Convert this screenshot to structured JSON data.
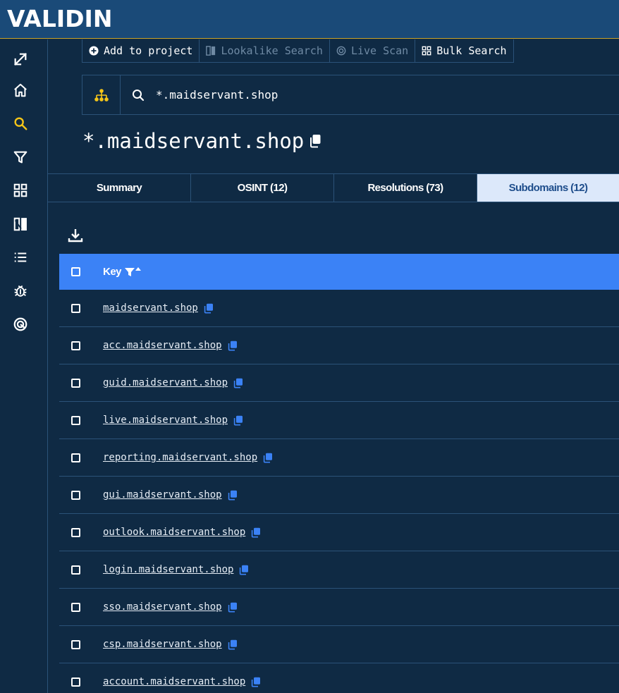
{
  "app": {
    "logo_text": "VALIDIN"
  },
  "colors": {
    "accent": "#3b82f6",
    "header_bg": "#1a4a78",
    "page_bg": "#0f2a44",
    "active_icon": "#f5c518",
    "active_tab_bg": "#dce8fa"
  },
  "sidebar": {
    "items": [
      {
        "icon": "expand-icon",
        "active": false
      },
      {
        "icon": "home-icon",
        "active": false
      },
      {
        "icon": "search-icon",
        "active": true
      },
      {
        "icon": "filter-icon",
        "active": false
      },
      {
        "icon": "grid-icon",
        "active": false
      },
      {
        "icon": "compare-icon",
        "active": false
      },
      {
        "icon": "list-icon",
        "active": false
      },
      {
        "icon": "bug-icon",
        "active": false
      },
      {
        "icon": "target-icon",
        "active": false
      }
    ]
  },
  "toolbar": {
    "add_to_project": "Add to project",
    "lookalike_search": "Lookalike Search",
    "live_scan": "Live Scan",
    "bulk_search": "Bulk Search"
  },
  "search": {
    "value": "*.maidservant.shop"
  },
  "page": {
    "title": "*.maidservant.shop"
  },
  "tabs": [
    {
      "label": "Summary",
      "active": false
    },
    {
      "label": "OSINT (12)",
      "active": false
    },
    {
      "label": "Resolutions (73)",
      "active": false
    },
    {
      "label": "Subdomains (12)",
      "active": true
    }
  ],
  "table": {
    "header_key": "Key",
    "rows": [
      "maidservant.shop",
      "acc.maidservant.shop",
      "guid.maidservant.shop",
      "live.maidservant.shop",
      "reporting.maidservant.shop",
      "gui.maidservant.shop",
      "outlook.maidservant.shop",
      "login.maidservant.shop",
      "sso.maidservant.shop",
      "csp.maidservant.shop",
      "account.maidservant.shop"
    ]
  }
}
